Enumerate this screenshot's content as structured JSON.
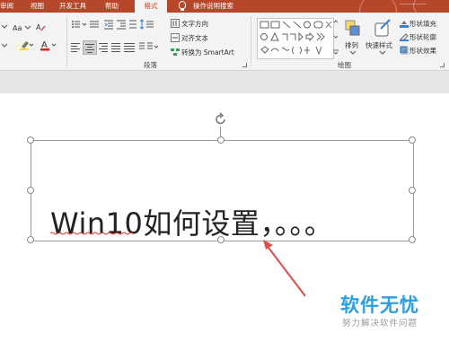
{
  "tabs": [
    {
      "label": "审阅"
    },
    {
      "label": "视图"
    },
    {
      "label": "开发工具"
    },
    {
      "label": "帮助"
    },
    {
      "label": "格式"
    }
  ],
  "tell_me": "操作说明搜索",
  "paragraph": {
    "text_direction": "文字方向",
    "align_text": "对齐文本",
    "convert_smartart": "转换为 SmartArt",
    "group_label": "段落"
  },
  "drawing": {
    "arrange": "排列",
    "quick_styles": "快速样式",
    "shape_fill": "形状填充",
    "shape_outline": "形状轮廓",
    "shape_effects": "形状效果",
    "group_label": "绘图"
  },
  "slide": {
    "text": "Win10如何设置，。。。"
  },
  "watermark": {
    "title": "软件无忧",
    "subtitle": "努力解决软件问题"
  },
  "colors": {
    "accent": "#b7472a",
    "arrow": "#e04d4d",
    "watermark": "#2a9fe0"
  }
}
